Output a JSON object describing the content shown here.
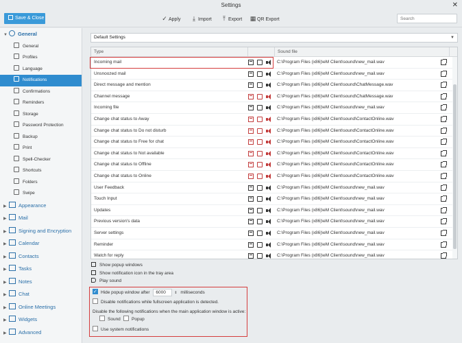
{
  "window": {
    "title": "Settings"
  },
  "toolbar": {
    "save_close": "Save & Close",
    "apply": "Apply",
    "import": "Import",
    "export": "Export",
    "qr_export": "QR Export",
    "search_placeholder": "Search"
  },
  "sidebar": {
    "general": {
      "label": "General",
      "items": [
        "General",
        "Profiles",
        "Language",
        "Notifications",
        "Confirmations",
        "Reminders",
        "Storage",
        "Password Protection",
        "Backup",
        "Print",
        "Spell-Checker",
        "Shortcuts",
        "Folders",
        "Swipe"
      ],
      "active": "Notifications"
    },
    "groups": [
      "Appearance",
      "Mail",
      "Signing and Encryption",
      "Calendar",
      "Contacts",
      "Tasks",
      "Notes",
      "Chat",
      "Online Meetings",
      "Widgets",
      "Advanced"
    ]
  },
  "main": {
    "profile": "Default Settings",
    "columns": {
      "type": "Type",
      "sound": "Sound file"
    },
    "rows": [
      {
        "type": "Incoming mail",
        "sound": "C:\\Program Files (x86)\\eM Client\\sound\\new_mail.wav"
      },
      {
        "type": "Unsnoozed mail",
        "sound": "C:\\Program Files (x86)\\eM Client\\sound\\new_mail.wav"
      },
      {
        "type": "Direct message and mention",
        "sound": "C:\\Program Files (x86)\\eM Client\\sound\\ChatMessage.wav"
      },
      {
        "type": "Channel message",
        "sound": "C:\\Program Files (x86)\\eM Client\\sound\\ChatMessage.wav"
      },
      {
        "type": "Incoming file",
        "sound": "C:\\Program Files (x86)\\eM Client\\sound\\new_mail.wav"
      },
      {
        "type": "Change chat status to Away",
        "sound": "C:\\Program Files (x86)\\eM Client\\sound\\ContactOnline.wav"
      },
      {
        "type": "Change chat status to Do not disturb",
        "sound": "C:\\Program Files (x86)\\eM Client\\sound\\ContactOnline.wav"
      },
      {
        "type": "Change chat status to Free for chat",
        "sound": "C:\\Program Files (x86)\\eM Client\\sound\\ContactOnline.wav"
      },
      {
        "type": "Change chat status to Not available",
        "sound": "C:\\Program Files (x86)\\eM Client\\sound\\ContactOnline.wav"
      },
      {
        "type": "Change chat status to Offline",
        "sound": "C:\\Program Files (x86)\\eM Client\\sound\\ContactOnline.wav"
      },
      {
        "type": "Change chat status to Online",
        "sound": "C:\\Program Files (x86)\\eM Client\\sound\\ContactOnline.wav"
      },
      {
        "type": "User Feedback",
        "sound": "C:\\Program Files (x86)\\eM Client\\sound\\new_mail.wav"
      },
      {
        "type": "Touch Input",
        "sound": "C:\\Program Files (x86)\\eM Client\\sound\\new_mail.wav"
      },
      {
        "type": "Updates",
        "sound": "C:\\Program Files (x86)\\eM Client\\sound\\new_mail.wav"
      },
      {
        "type": "Previous version's data",
        "sound": "C:\\Program Files (x86)\\eM Client\\sound\\new_mail.wav"
      },
      {
        "type": "Server settings",
        "sound": "C:\\Program Files (x86)\\eM Client\\sound\\new_mail.wav"
      },
      {
        "type": "Reminder",
        "sound": "C:\\Program Files (x86)\\eM Client\\sound\\new_mail.wav"
      },
      {
        "type": "Watch for reply",
        "sound": "C:\\Program Files (x86)\\eM Client\\sound\\new_mail.wav"
      }
    ],
    "legend": {
      "popup": "Show popup windows",
      "tray": "Show notification icon in the tray area",
      "sound": "Play sound"
    },
    "options": {
      "hide_popup": "Hide popup window after",
      "hide_popup_value": "6000",
      "milliseconds": "milliseconds",
      "disable_fullscreen": "Disable notifications while fullscreen application is detected.",
      "disable_following": "Disable the following notifications when the main application window is active:",
      "sound": "Sound",
      "popup": "Popup",
      "use_system": "Use system notifications"
    }
  },
  "colors": {
    "accent": "#2f8ccf",
    "highlight": "#d43b3b",
    "disabled_icon": "#c23b3b"
  }
}
